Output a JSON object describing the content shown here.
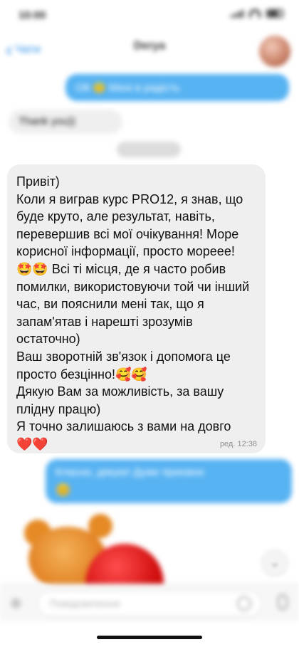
{
  "status": {
    "time": "10:00"
  },
  "header": {
    "back_label": "Чати",
    "title": "Derya",
    "subtitle": ""
  },
  "messages": {
    "m1": {
      "text": "Ой 😇 Мені в радість",
      "time": ""
    },
    "m2": {
      "text": "Thank you))",
      "time": ""
    },
    "m3": {
      "text": "Привіт)\nКоли я виграв курс PRO12, я знав, що буде круто, але результат, навіть, перевершив всі мої очікування! Море корисної інформації, просто мореее!\n🤩🤩 Всі ті місця, де я часто робив помилки, використовуючи той чи інший час, ви пояснили мені так, що я запам'ятав і нарешті зрозумів остаточно)\nВаш зворотній зв'язок і допомога це просто безцінно!🥰🥰\nДякую Вам за можливість, за вашу плідну працю)\nЯ точно залишаюсь з вами на довго\n❤️❤️",
      "meta": "ред. 12:38"
    },
    "m4": {
      "text": "Класно, дякую! Дуже приємно",
      "emoji": "😊",
      "time": ""
    }
  },
  "input": {
    "placeholder": "Повідомлення"
  },
  "icons": {
    "back": "chevron-left-icon",
    "attach": "attach-icon",
    "sticker": "sticker-icon",
    "mic": "microphone-icon",
    "scroll": "chevron-down-icon"
  },
  "colors": {
    "outgoing": "#58b3f2",
    "incoming": "#efefef",
    "accent": "#2a8ee8"
  }
}
